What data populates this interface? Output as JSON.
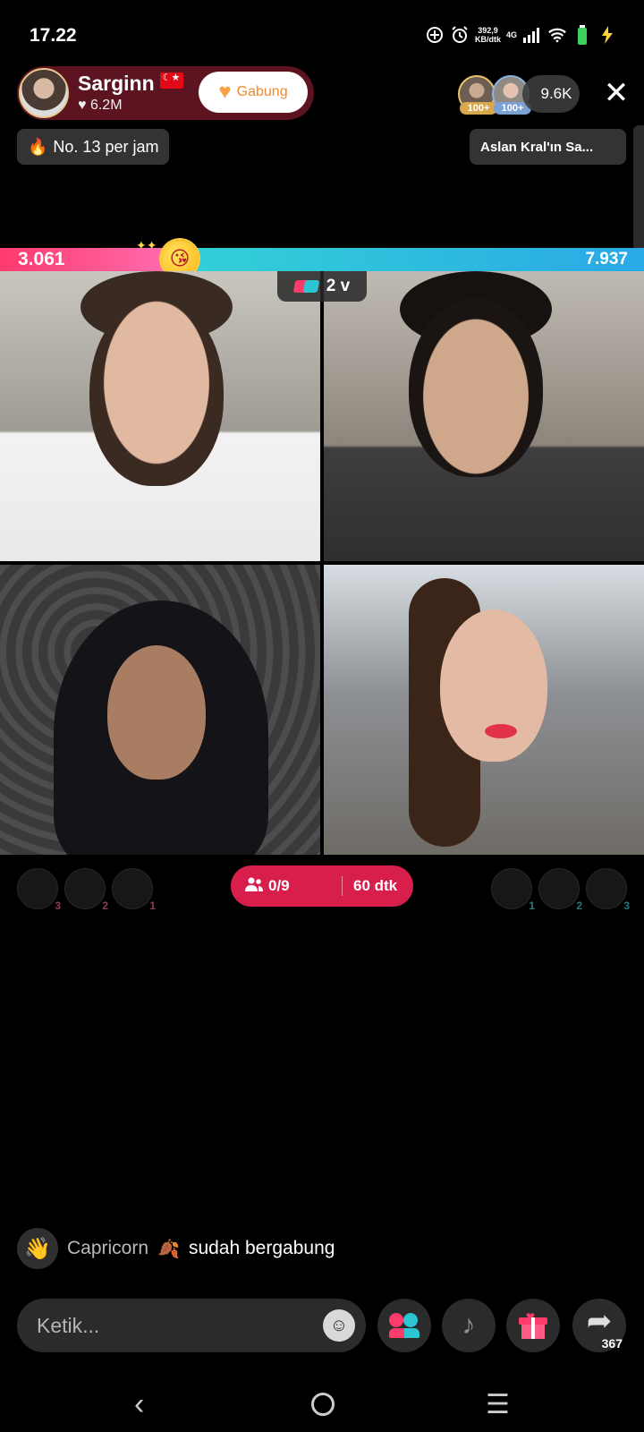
{
  "status_bar": {
    "time": "17.22",
    "net_speed": "392,9",
    "net_unit": "KB/dtk",
    "net_type": "4G",
    "icons": [
      "data-saver-icon",
      "alarm-icon",
      "signal-icon",
      "wifi-icon",
      "battery-icon",
      "charging-icon"
    ]
  },
  "host": {
    "name": "Sarginn",
    "flag": "turkey-flag-icon",
    "likes": "♥ 6.2M",
    "join_label": "Gabung"
  },
  "rank": {
    "label": "No. 13 per jam"
  },
  "top_right": {
    "viewer_badges": [
      "100+",
      "100+"
    ],
    "viewer_count": "9.6K",
    "close_glyph": "✕",
    "gift_pill": "Aslan Kral'ın Sa..."
  },
  "battle": {
    "score_left": "3.061",
    "score_right": "7.937",
    "left_fraction": 0.278,
    "round_label": "2 v",
    "colors": {
      "left": "#ff3a6e",
      "right": "#2aa9e6"
    }
  },
  "supporters_left": [
    "3",
    "2",
    "1"
  ],
  "supporters_right": [
    "1",
    "2",
    "3"
  ],
  "timer": {
    "guests": "0/9",
    "time": "60 dtk"
  },
  "chat": {
    "user": "Capricorn",
    "message": "sudah bergabung"
  },
  "bottom": {
    "input_placeholder": "Ketik...",
    "share_count": "367"
  },
  "colors": {
    "accent_pink": "#ff3b6b",
    "accent_teal": "#2ec5d3",
    "timer_red": "#d81e4b",
    "host_card": "#5b1420"
  }
}
